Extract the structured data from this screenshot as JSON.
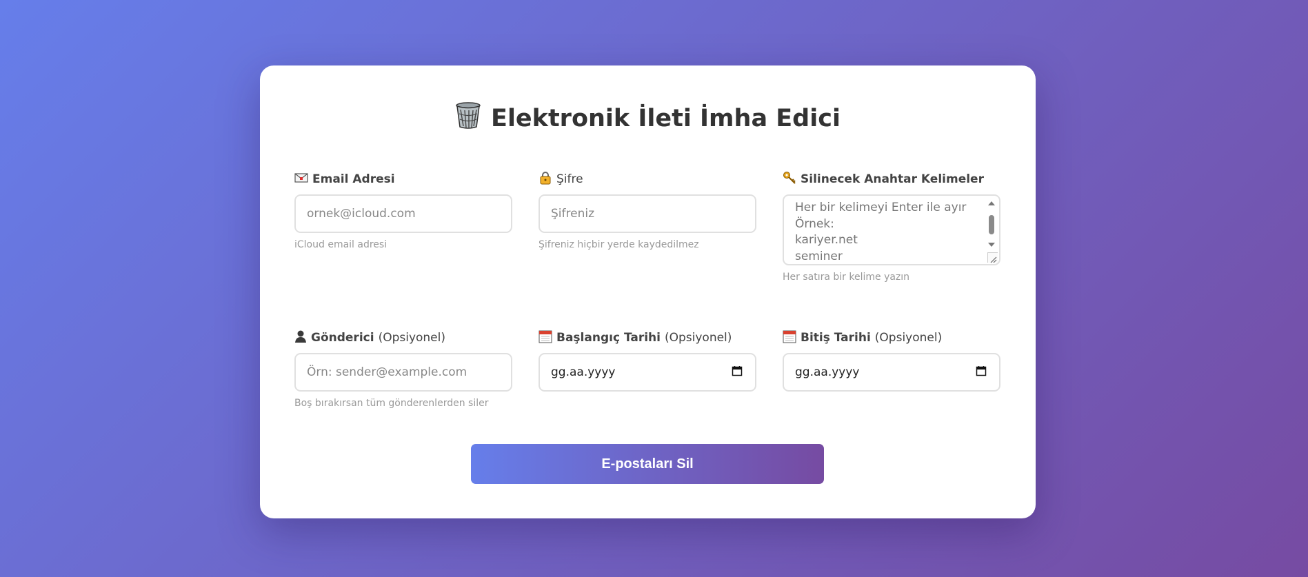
{
  "title": "Elektronik İleti İmha Edici",
  "fields": {
    "email": {
      "label": "Email Adresi",
      "placeholder": "ornek@icloud.com",
      "help": "iCloud email adresi",
      "icon": "envelope-icon"
    },
    "password": {
      "label": "Şifre",
      "placeholder": "Şifreniz",
      "help": "Şifreniz hiçbir yerde kaydedilmez",
      "icon": "lock-icon"
    },
    "keywords": {
      "label": "Silinecek Anahtar Kelimeler",
      "placeholder_lines": [
        "Her bir kelimeyi Enter ile ayır",
        "Örnek:",
        "kariyer.net",
        "seminer"
      ],
      "help": "Her satıra bir kelime yazın",
      "icon": "key-icon"
    },
    "sender": {
      "label": "Gönderici",
      "optional": "(Opsiyonel)",
      "placeholder": "Örn: sender@example.com",
      "help": "Boş bırakırsan tüm gönderenlerden siler",
      "icon": "person-icon"
    },
    "start_date": {
      "label": "Başlangıç Tarihi",
      "optional": "(Opsiyonel)",
      "value": "gg.aa.yyyy",
      "icon": "calendar-icon"
    },
    "end_date": {
      "label": "Bitiş Tarihi",
      "optional": "(Opsiyonel)",
      "value": "gg.aa.yyyy",
      "icon": "calendar-icon"
    }
  },
  "submit_label": "E-postaları Sil",
  "colors": {
    "gradient_start": "#667eea",
    "gradient_end": "#764ba2",
    "card": "#ffffff",
    "title": "#333333",
    "help": "#999999"
  }
}
